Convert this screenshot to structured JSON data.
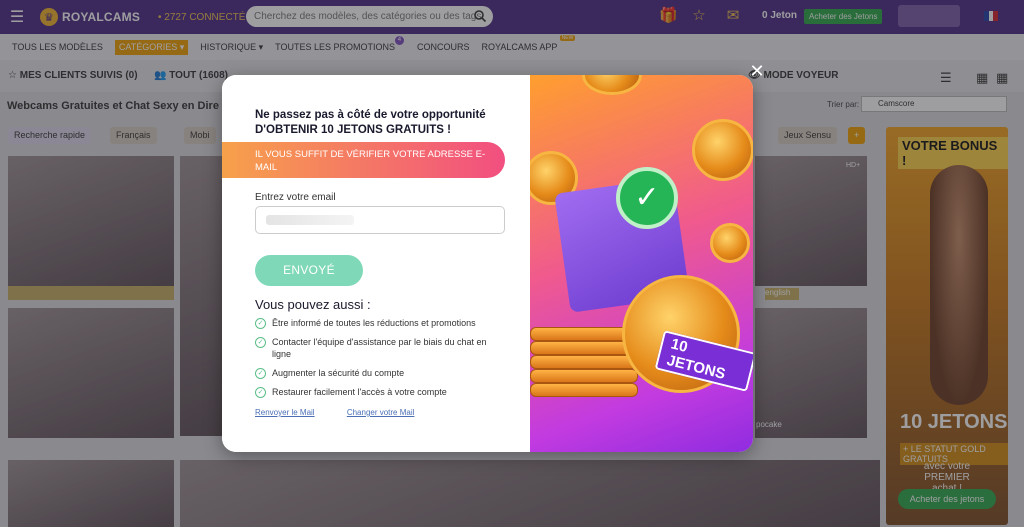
{
  "header": {
    "brand": "ROYALCAMS",
    "online_count": "• 2727 CONNECTÉ",
    "search_placeholder": "Cherchez des modèles, des catégories ou des tags",
    "tokens": "0 Jeton",
    "buy_tokens": "Acheter des Jetons"
  },
  "nav": {
    "items": [
      "TOUS LES MODÈLES",
      "CATÉGORIES ▾",
      "HISTORIQUE ▾",
      "TOUTES LES PROMOTIONS",
      "CONCOURS",
      "ROYALCAMS APP"
    ],
    "promo_badge": "4",
    "app_badge": "NEW"
  },
  "filters": {
    "my_clients": "MES CLIENTS SUIVIS (0)",
    "all": "TOUT (1608)",
    "voyeur": "MODE VOYEUR"
  },
  "page": {
    "title": "Webcams Gratuites et Chat Sexy en Dire",
    "sort_label": "Trier par:",
    "sort_value": "Camscore",
    "quick_search": "Recherche rapide",
    "chip_fr": "Français",
    "chip_mobile": "Mobi",
    "chip_sensual": "Jeux Sensu",
    "chip_plus": "+",
    "tile_labels": [
      "english",
      "pocake",
      "HD+"
    ]
  },
  "promo_banner": {
    "title": "VOTRE BONUS !",
    "big": "10 JETONS",
    "status": "+ LE STATUT GOLD GRATUITS",
    "avec": "avec votre PREMIER achat !",
    "button": "Acheter des jetons"
  },
  "modal": {
    "headline": "Ne passez pas à côté de votre opportunité D'OBTENIR 10 JETONS GRATUITS !",
    "banner": "IL VOUS SUFFIT DE VÉRIFIER VOTRE ADRESSE E-MAIL",
    "email_label": "Entrez votre email",
    "send_button": "ENVOYÉ",
    "also_title": "Vous pouvez aussi :",
    "benefits": [
      "Être informé de toutes les réductions et promotions",
      "Contacter l'équipe d'assistance par le biais du chat en ligne",
      "Augmenter la sécurité du compte",
      "Restaurer facilement l'accès à votre compte"
    ],
    "resend_link": "Renvoyer le Mail",
    "change_link": "Changer votre Mail",
    "ribbon": "10 JETONS"
  },
  "colors": {
    "header": "#4b2a85",
    "accent": "#f0a000",
    "send_button": "#7fd8b8",
    "check": "#5cbf88"
  }
}
